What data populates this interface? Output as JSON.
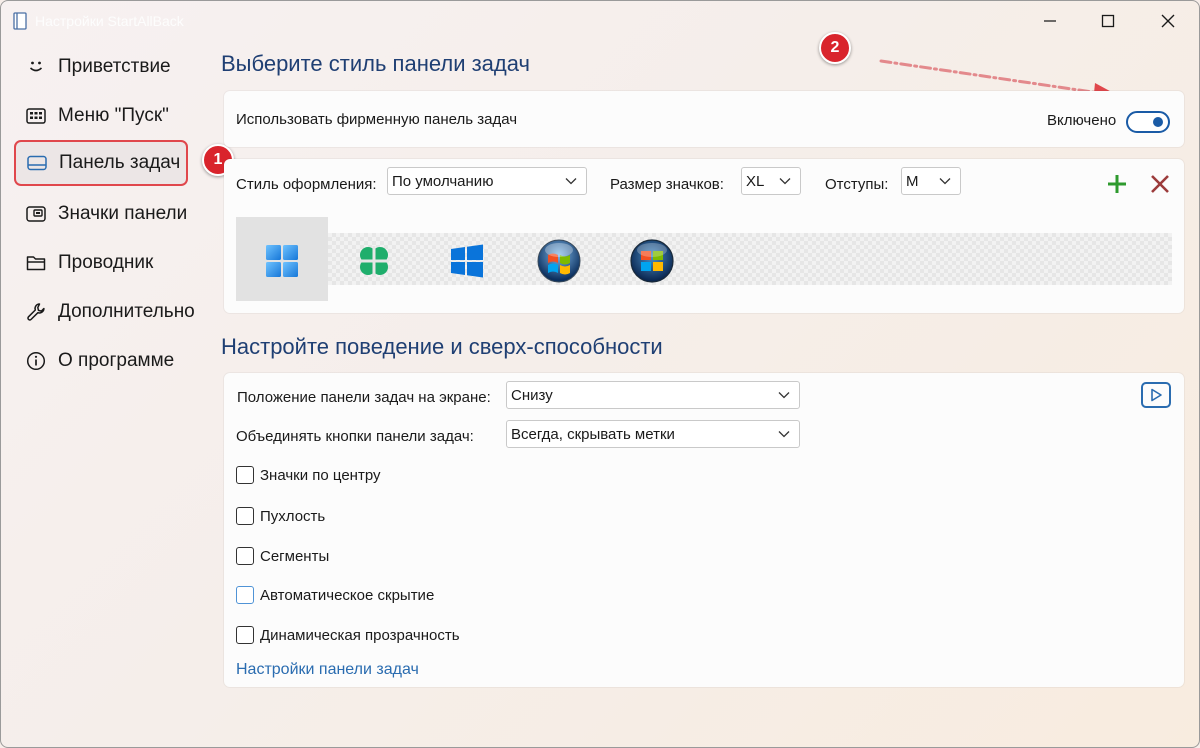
{
  "window": {
    "title": "Настройки StartAllBack",
    "minimize_glyph": "—",
    "maximize_glyph": "☐",
    "close_glyph": "✕"
  },
  "sidebar": {
    "items": [
      {
        "label": "Приветствие",
        "icon": "smile-icon"
      },
      {
        "label": "Меню \"Пуск\"",
        "icon": "start-menu-icon"
      },
      {
        "label": "Панель задач",
        "icon": "taskbar-icon",
        "active": true
      },
      {
        "label": "Значки панели",
        "icon": "tray-icon"
      },
      {
        "label": "Проводник",
        "icon": "folder-icon"
      },
      {
        "label": "Дополнительно",
        "icon": "wrench-icon"
      },
      {
        "label": "О программе",
        "icon": "info-icon"
      }
    ]
  },
  "callouts": {
    "one": "1",
    "two": "2"
  },
  "colors": {
    "accent": "#1a5ba6",
    "heading": "#1f3f73",
    "link": "#2a6cb0",
    "callout": "#d9242c",
    "active_outline": "#e0474c",
    "add": "#2e9a2e",
    "remove": "#9c3b3b"
  },
  "section1": {
    "title": "Выберите стиль панели задач",
    "enable_label": "Использовать фирменную панель задач",
    "toggle_state_label": "Включено",
    "toggle_on": true,
    "style_label": "Стиль оформления:",
    "style_value": "По умолчанию",
    "icon_size_label": "Размер значков:",
    "icon_size_value": "XL",
    "padding_label": "Отступы:",
    "padding_value": "M",
    "add_button": "+",
    "remove_button": "✕",
    "style_options": [
      "windows11-logo-icon",
      "clover-logo-icon",
      "windows10-logo-icon",
      "windows7-orb-icon",
      "windows-vista-orb-icon"
    ],
    "selected_style_index": 0
  },
  "section2": {
    "title": "Настройте поведение и сверх-способности",
    "position_label": "Положение панели задач на экране:",
    "position_value": "Снизу",
    "combine_label": "Объединять кнопки панели задач:",
    "combine_value": "Всегда, скрывать метки",
    "checkboxes": [
      {
        "label": "Значки по центру",
        "checked": false
      },
      {
        "label": "Пухлость",
        "checked": false
      },
      {
        "label": "Сегменты",
        "checked": false
      },
      {
        "label": "Автоматическое скрытие",
        "checked": false
      },
      {
        "label": "Динамическая прозрачность",
        "checked": false
      }
    ],
    "link": "Настройки панели задач"
  }
}
